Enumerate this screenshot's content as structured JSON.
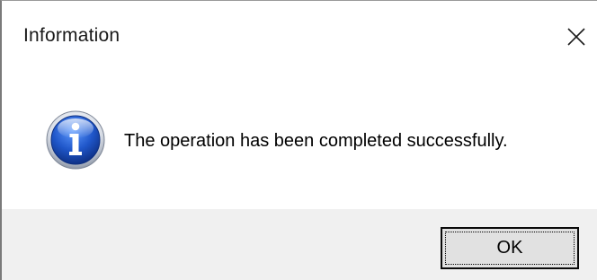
{
  "window": {
    "title": "Information",
    "close_icon": "close-icon"
  },
  "message": {
    "icon": "info-icon",
    "text": "The operation has been completed successfully."
  },
  "buttons": {
    "ok_label": "OK"
  },
  "colors": {
    "footer_background": "#f0f0f0",
    "button_background": "#e1e1e1",
    "icon_blue": "#1f56c9"
  }
}
